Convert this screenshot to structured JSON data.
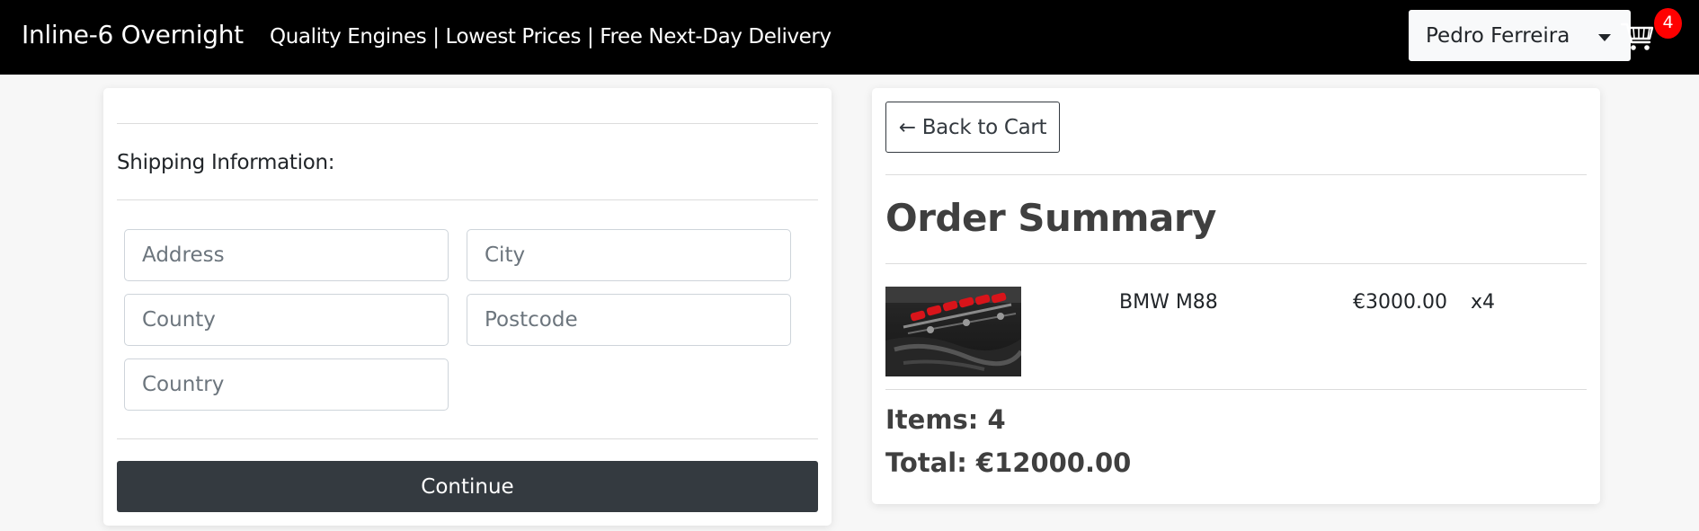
{
  "navbar": {
    "brand": "Inline-6 Overnight",
    "tagline": "Quality Engines | Lowest Prices | Free Next-Day Delivery",
    "user_name": "Pedro Ferreira",
    "cart_count": "4",
    "cart_icon": "shopping-cart-icon"
  },
  "shipping": {
    "label": "Shipping Information:",
    "fields": {
      "address": {
        "placeholder": "Address",
        "value": ""
      },
      "city": {
        "placeholder": "City",
        "value": ""
      },
      "county": {
        "placeholder": "County",
        "value": ""
      },
      "postcode": {
        "placeholder": "Postcode",
        "value": ""
      },
      "country": {
        "placeholder": "Country",
        "value": ""
      }
    },
    "continue_label": "Continue"
  },
  "summary": {
    "back_label": "← Back to Cart",
    "title": "Order Summary",
    "items": [
      {
        "name": "BMW M88",
        "price": "€3000.00",
        "qty": "x4",
        "image": "engine-photo"
      }
    ],
    "items_label": "Items: 4",
    "total_label": "Total: €12000.00"
  },
  "colors": {
    "navbar_bg": "#000000",
    "badge": "#ff0000",
    "button_dark": "#343a40",
    "page_bg": "#f7f7f7"
  }
}
